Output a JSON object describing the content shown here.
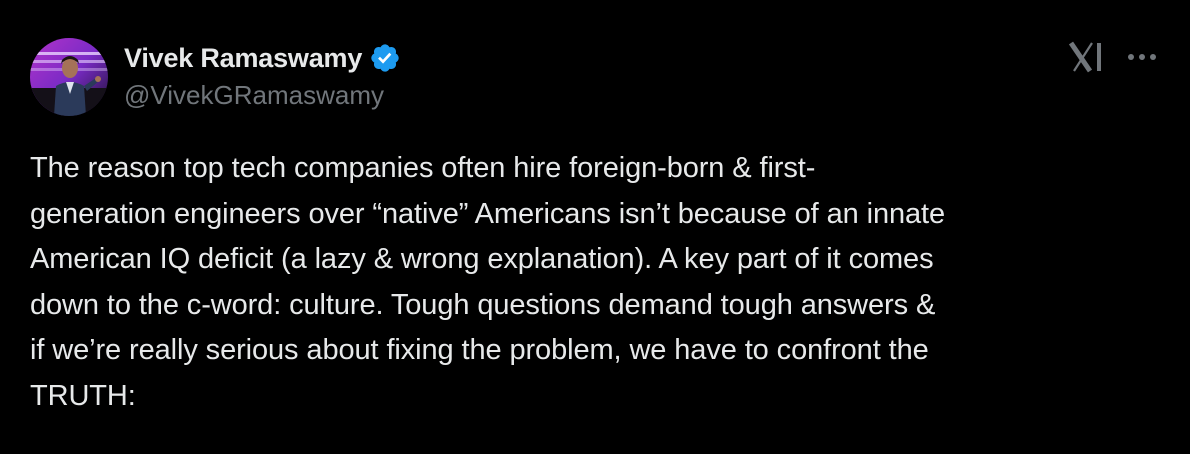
{
  "author": {
    "display_name": "Vivek Ramaswamy",
    "handle": "@VivekGRamaswamy",
    "verified": true,
    "avatar_icon": "profile-photo"
  },
  "header": {
    "brand_icon": "x-logo-icon",
    "more_icon": "more-options-icon"
  },
  "tweet": {
    "text": "The reason top tech companies often hire foreign-born & first-\ngeneration engineers over “native” Americans isn’t because of an innate\nAmerican IQ deficit (a lazy & wrong explanation). A key part of it comes\ndown to the c-word: culture. Tough questions demand tough answers &\nif we’re really serious about fixing the problem, we have to confront the\nTRUTH:"
  },
  "colors": {
    "background": "#000000",
    "primary_text": "#e7e9ea",
    "secondary_text": "#71767b",
    "verified_badge": "#1d9bf0"
  }
}
